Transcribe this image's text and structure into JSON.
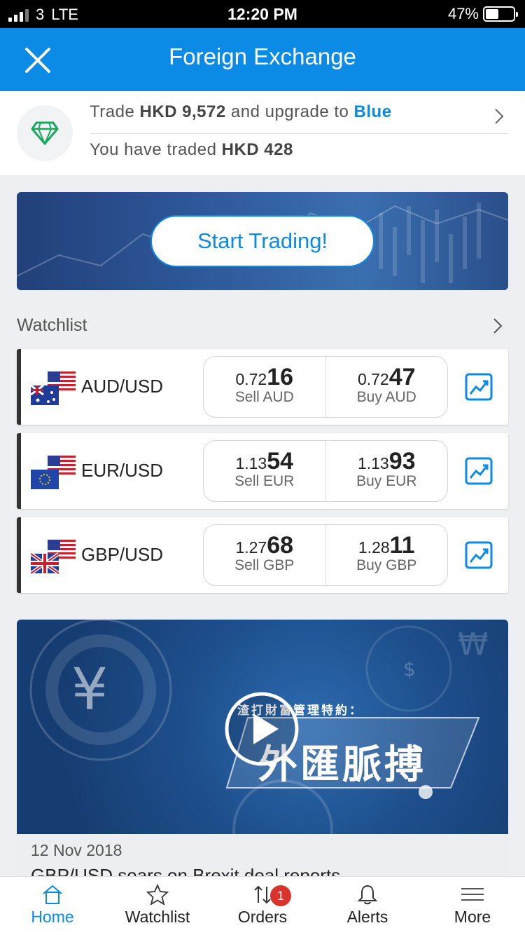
{
  "status_bar": {
    "carrier": "3",
    "network": "LTE",
    "time": "12:20 PM",
    "battery": "47%",
    "battery_level": 0.47
  },
  "header": {
    "title": "Foreign Exchange",
    "close_icon": "close-icon"
  },
  "promo": {
    "line1": {
      "prefix": "Trade ",
      "amount": "HKD 9,572",
      "middle": " and upgrade to ",
      "tier": "Blue"
    },
    "line2": {
      "prefix": "You have traded ",
      "amount": "HKD 428"
    }
  },
  "banner": {
    "button_label": "Start Trading!"
  },
  "watchlist": {
    "title": "Watchlist",
    "pairs": [
      {
        "pair": "AUD/USD",
        "sell_small": "0.72",
        "sell_big": "16",
        "sell_label": "Sell AUD",
        "buy_small": "0.72",
        "buy_big": "47",
        "buy_label": "Buy AUD"
      },
      {
        "pair": "EUR/USD",
        "sell_small": "1.13",
        "sell_big": "54",
        "sell_label": "Sell EUR",
        "buy_small": "1.13",
        "buy_big": "93",
        "buy_label": "Buy EUR"
      },
      {
        "pair": "GBP/USD",
        "sell_small": "1.27",
        "sell_big": "68",
        "sell_label": "Sell GBP",
        "buy_small": "1.28",
        "buy_big": "11",
        "buy_label": "Buy GBP"
      }
    ]
  },
  "video": {
    "overlay_title": "渣打財富管理特約：",
    "overlay_main": "外匯脈搏",
    "date": "12 Nov 2018",
    "headline": "GBP/USD soars on Brexit deal reports"
  },
  "tabbar": {
    "tabs": [
      {
        "label": "Home",
        "icon": "home-icon"
      },
      {
        "label": "Watchlist",
        "icon": "star-icon"
      },
      {
        "label": "Orders",
        "icon": "orders-icon",
        "badge": "1"
      },
      {
        "label": "Alerts",
        "icon": "bell-icon"
      },
      {
        "label": "More",
        "icon": "menu-icon"
      }
    ]
  },
  "colors": {
    "accent": "#0b8ae6",
    "badge": "#d9342b",
    "promo_gem": "#1aa85c"
  }
}
